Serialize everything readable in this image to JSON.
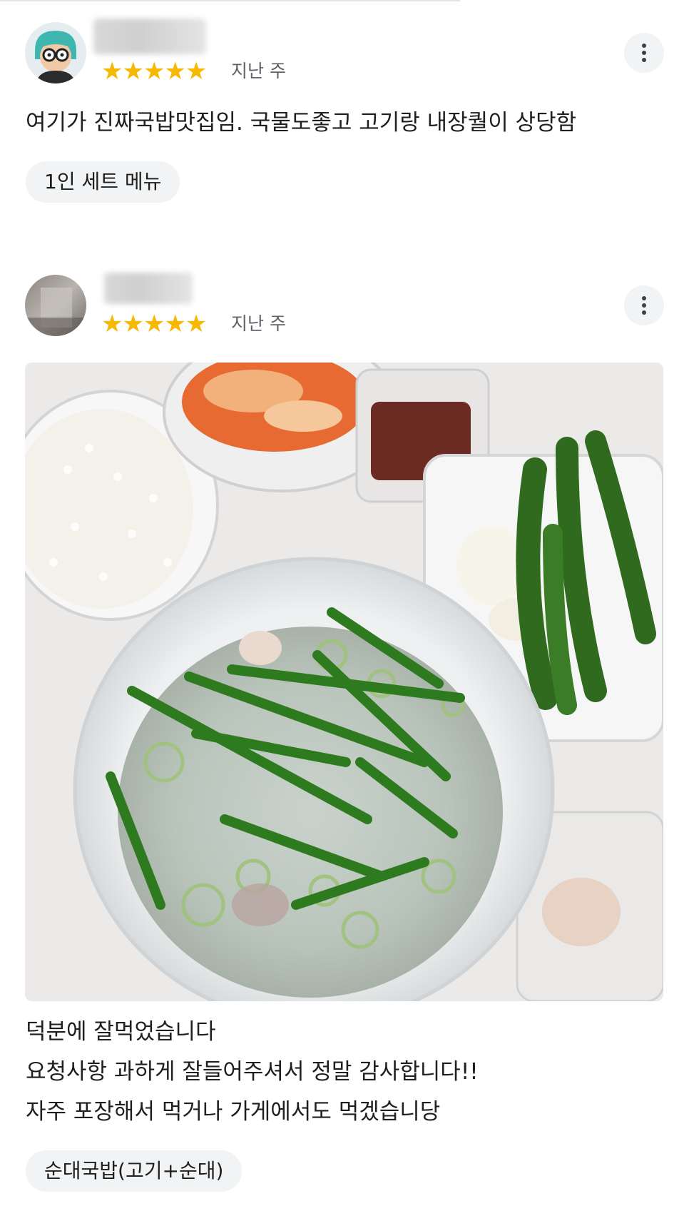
{
  "reviews": [
    {
      "rating_stars": "★★★★★",
      "time": "지난 주",
      "text_lines": [
        "여기가 진짜국밥맛집임. 국물도좋고 고기랑 내장퀄이 상당함"
      ],
      "chip": "1인 세트 메뉴",
      "avatar_icon": "cartoon-avatar-icon",
      "rating": 5
    },
    {
      "rating_stars": "★★★★★",
      "time": "지난 주",
      "text_lines": [
        "덕분에 잘먹었습니다",
        "요청사항 과하게 잘들어주셔서 정말 감사합니다!!",
        "자주 포장해서 먹거나 가게에서도 먹겠습니당"
      ],
      "chip": "순대국밥(고기+순대)",
      "avatar_icon": "user-photo-avatar-icon",
      "rating": 5
    }
  ],
  "colors": {
    "star": "#f6b800",
    "chip_bg": "#f1f3f4",
    "secondary_text": "#5f6368"
  }
}
